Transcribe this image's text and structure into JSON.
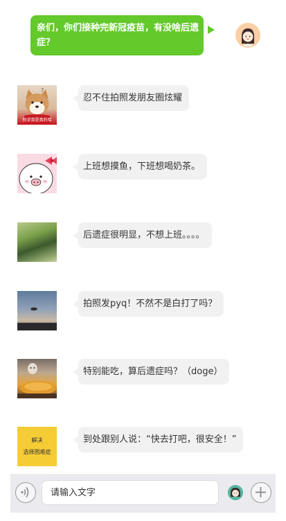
{
  "outgoing": {
    "text": "亲们，你们接种完新冠疫苗，有没啥后遗症？",
    "bubble_color": "#64c92b"
  },
  "incoming": [
    {
      "text": "忍不住拍照发朋友圈炫耀",
      "avatar_caption": "别说我是真的哈"
    },
    {
      "text": "上班想摸鱼，下班想喝奶茶。"
    },
    {
      "text": "后遗症很明显，不想上班。。。。"
    },
    {
      "text": "拍照发pyq！不然不是白打了吗？"
    },
    {
      "text": "特别能吃，算后遗症吗？（doge）"
    },
    {
      "text": "到处跟别人说：“快去打吧，很安全！”",
      "avatar_line1": "解决",
      "avatar_line2": "选择困难症"
    }
  ],
  "input_bar": {
    "placeholder": "请输入文字",
    "icons": [
      "voice-icon",
      "emoji-icon",
      "plus-icon"
    ]
  }
}
